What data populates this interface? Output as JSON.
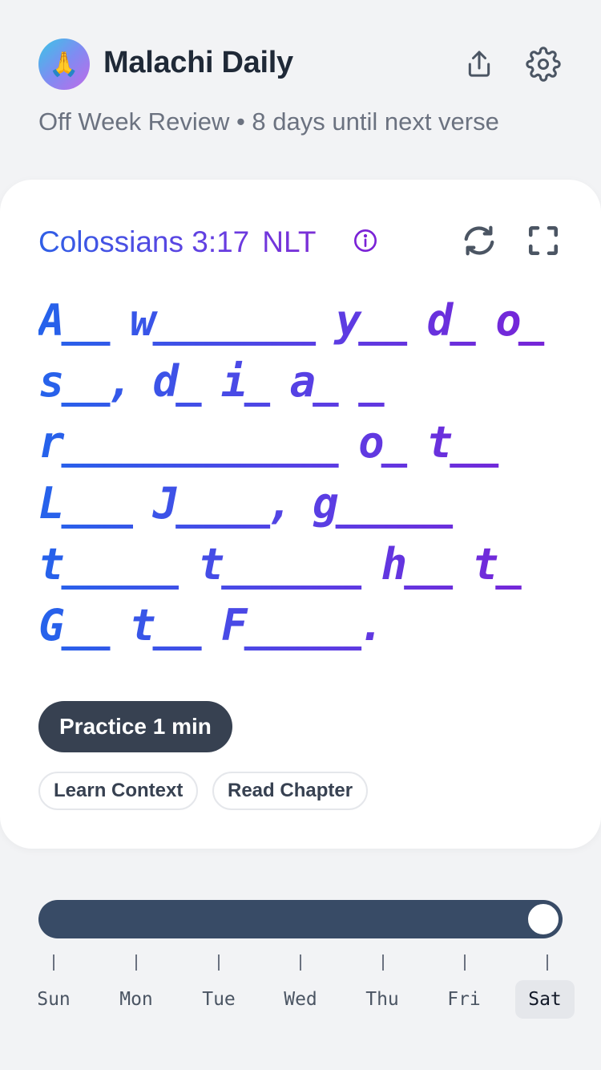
{
  "header": {
    "logo_glyph": "🙏",
    "title": "Malachi Daily",
    "share_icon": "share-icon",
    "settings_icon": "gear-icon"
  },
  "subtitle": "Off Week Review • 8 days until next verse",
  "card": {
    "reference": "Colossians 3:17",
    "translation": "NLT",
    "verse_lines": [
      "A__ w_______ y__ d_ o_",
      "s__, d_ i_ a_ _",
      "r____________ o_ t__",
      "L___ J____, g_____",
      "t_____ t______ h__ t_",
      "G__ t__ F_____."
    ],
    "practice_label": "Practice 1 min",
    "learn_context_label": "Learn Context",
    "read_chapter_label": "Read Chapter"
  },
  "week": {
    "days": [
      "Sun",
      "Mon",
      "Tue",
      "Wed",
      "Thu",
      "Fri",
      "Sat"
    ],
    "selected_day": "Sat",
    "slider_progress": 1.0
  },
  "colors": {
    "accent_blue": "#2563eb",
    "accent_purple": "#7a22d6",
    "dark_button": "#374151",
    "slider": "#384b66"
  }
}
